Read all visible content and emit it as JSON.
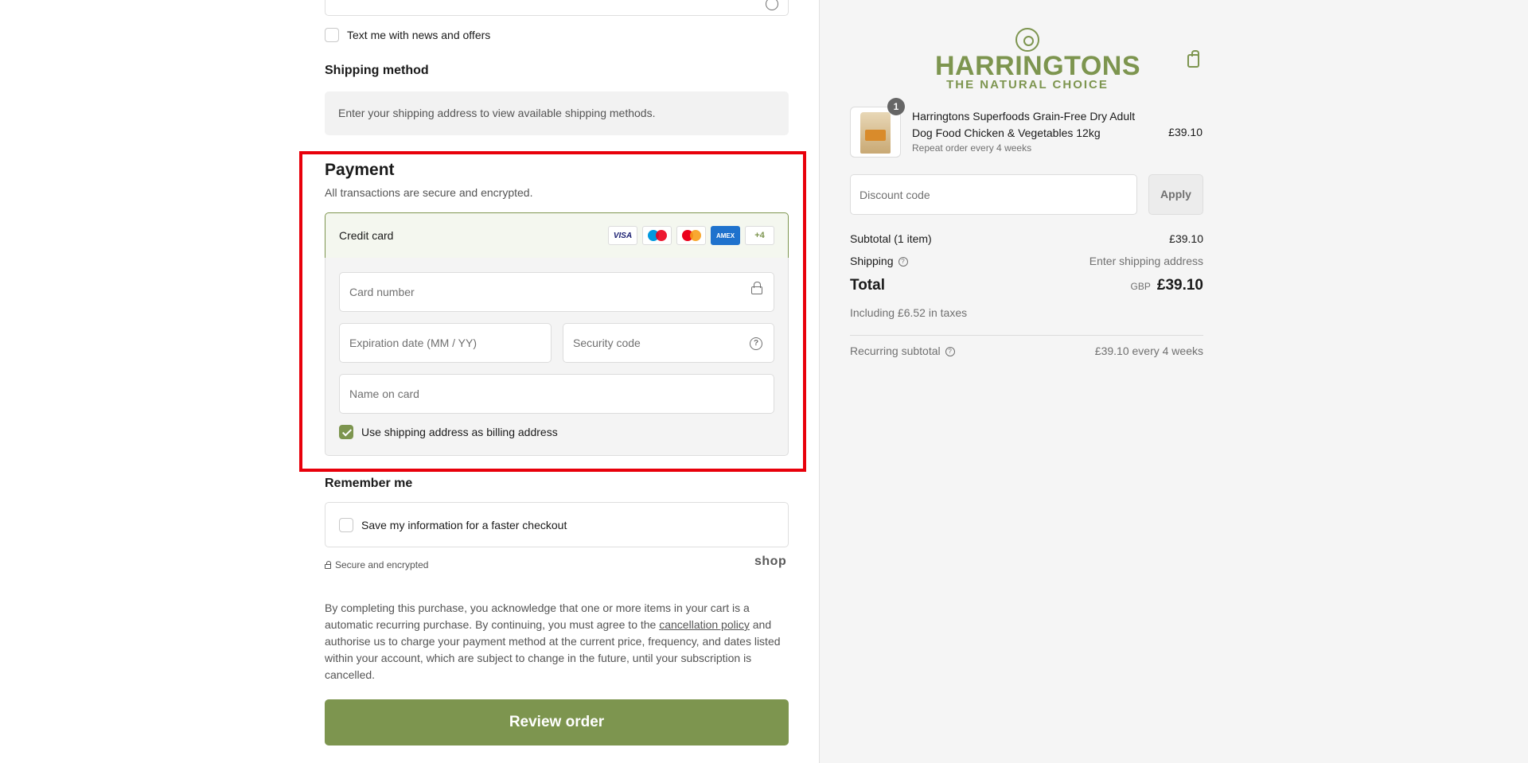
{
  "contact": {
    "sms_label": "Text me with news and offers"
  },
  "shipping": {
    "heading": "Shipping method",
    "message": "Enter your shipping address to view available shipping methods."
  },
  "payment": {
    "heading": "Payment",
    "subtitle": "All transactions are secure and encrypted.",
    "method_label": "Credit card",
    "brands": [
      "VISA",
      "maestro",
      "mastercard",
      "AMEX"
    ],
    "more_brands": "+4",
    "card_number_placeholder": "Card number",
    "expiry_placeholder": "Expiration date (MM / YY)",
    "security_placeholder": "Security code",
    "name_placeholder": "Name on card",
    "billing_label": "Use shipping address as billing address",
    "billing_checked": true
  },
  "remember": {
    "heading": "Remember me",
    "save_label": "Save my information for a faster checkout",
    "secure_text": "Secure and encrypted",
    "shop_logo": "shop"
  },
  "legal": {
    "text_before": "By completing this purchase, you acknowledge that one or more items in your cart is a automatic recurring purchase. By continuing, you must agree to the ",
    "link": "cancellation policy",
    "text_after": " and authorise us to charge your payment method at the current price, frequency, and dates listed within your account, which are subject to change in the future, until your subscription is cancelled."
  },
  "review_button": "Review order",
  "brand": {
    "name": "HARRINGTONS",
    "tagline": "THE NATURAL CHOICE",
    "color": "#7d954f"
  },
  "summary": {
    "item": {
      "quantity": "1",
      "name": "Harringtons Superfoods Grain-Free Dry Adult Dog Food Chicken & Vegetables 12kg",
      "subscription": "Repeat order every 4 weeks",
      "price": "£39.10"
    },
    "discount_placeholder": "Discount code",
    "apply_label": "Apply",
    "subtotal_label": "Subtotal (1 item)",
    "subtotal_value": "£39.10",
    "shipping_label": "Shipping",
    "shipping_value": "Enter shipping address",
    "total_label": "Total",
    "currency": "GBP",
    "total_value": "£39.10",
    "taxes": "Including £6.52 in taxes",
    "recurring_label": "Recurring subtotal",
    "recurring_value": "£39.10 every 4 weeks"
  },
  "colors": {
    "accent": "#7d954f",
    "highlight": "#e8000b"
  }
}
